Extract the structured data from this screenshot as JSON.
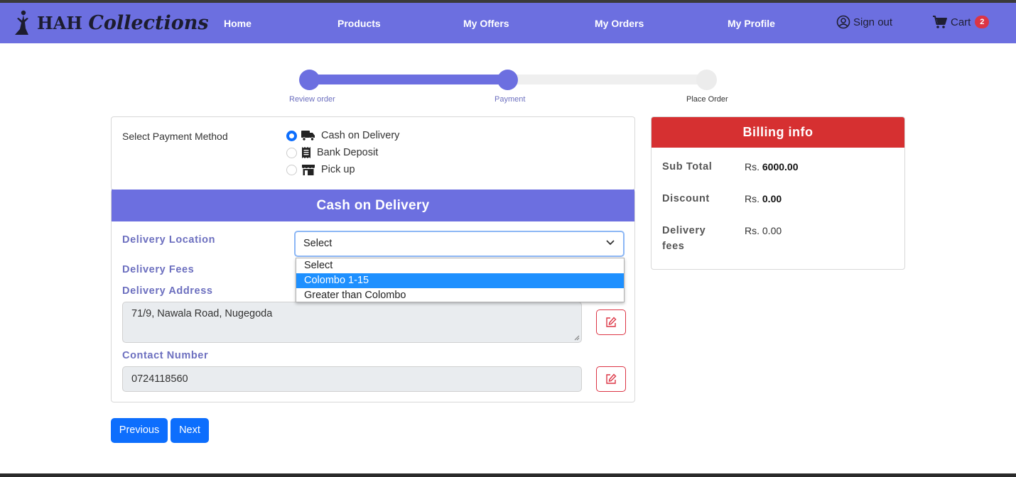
{
  "brand": {
    "prefix": "HAH",
    "script": "Collections"
  },
  "nav": {
    "home": "Home",
    "products": "Products",
    "offers": "My Offers",
    "orders": "My Orders",
    "profile": "My Profile",
    "signout": "Sign out",
    "cart": "Cart",
    "cart_count": "2"
  },
  "steps": [
    "Review order",
    "Payment",
    "Place Order"
  ],
  "payment": {
    "title": "Select Payment Method",
    "options": [
      {
        "label": "Cash on Delivery",
        "icon": "truck-icon",
        "selected": true
      },
      {
        "label": "Bank Deposit",
        "icon": "receipt-icon",
        "selected": false
      },
      {
        "label": "Pick up",
        "icon": "shop-icon",
        "selected": false
      }
    ]
  },
  "cod": {
    "header": "Cash on Delivery",
    "location_label": "Delivery Location",
    "location_value": "Select",
    "location_options": [
      "Select",
      "Colombo 1-15",
      "Greater than Colombo"
    ],
    "fees_label": "Delivery Fees",
    "address_label": "Delivery Address",
    "address_value": "71/9, Nawala Road, Nugegoda",
    "contact_label": "Contact Number",
    "contact_value": "0724118560"
  },
  "buttons": {
    "previous": "Previous",
    "next": "Next"
  },
  "billing": {
    "header": "Billing info",
    "subtotal_label": "Sub Total",
    "subtotal_prefix": "Rs.",
    "subtotal_value": "6000.00",
    "discount_label": "Discount",
    "discount_prefix": "Rs.",
    "discount_value": "0.00",
    "delivery_label_1": "Delivery",
    "delivery_label_2": "fees",
    "delivery_value": "Rs. 0.00"
  },
  "colors": {
    "accent": "#6c6fe0",
    "billing_header": "#d63031",
    "primary_button": "#0d6efd"
  }
}
